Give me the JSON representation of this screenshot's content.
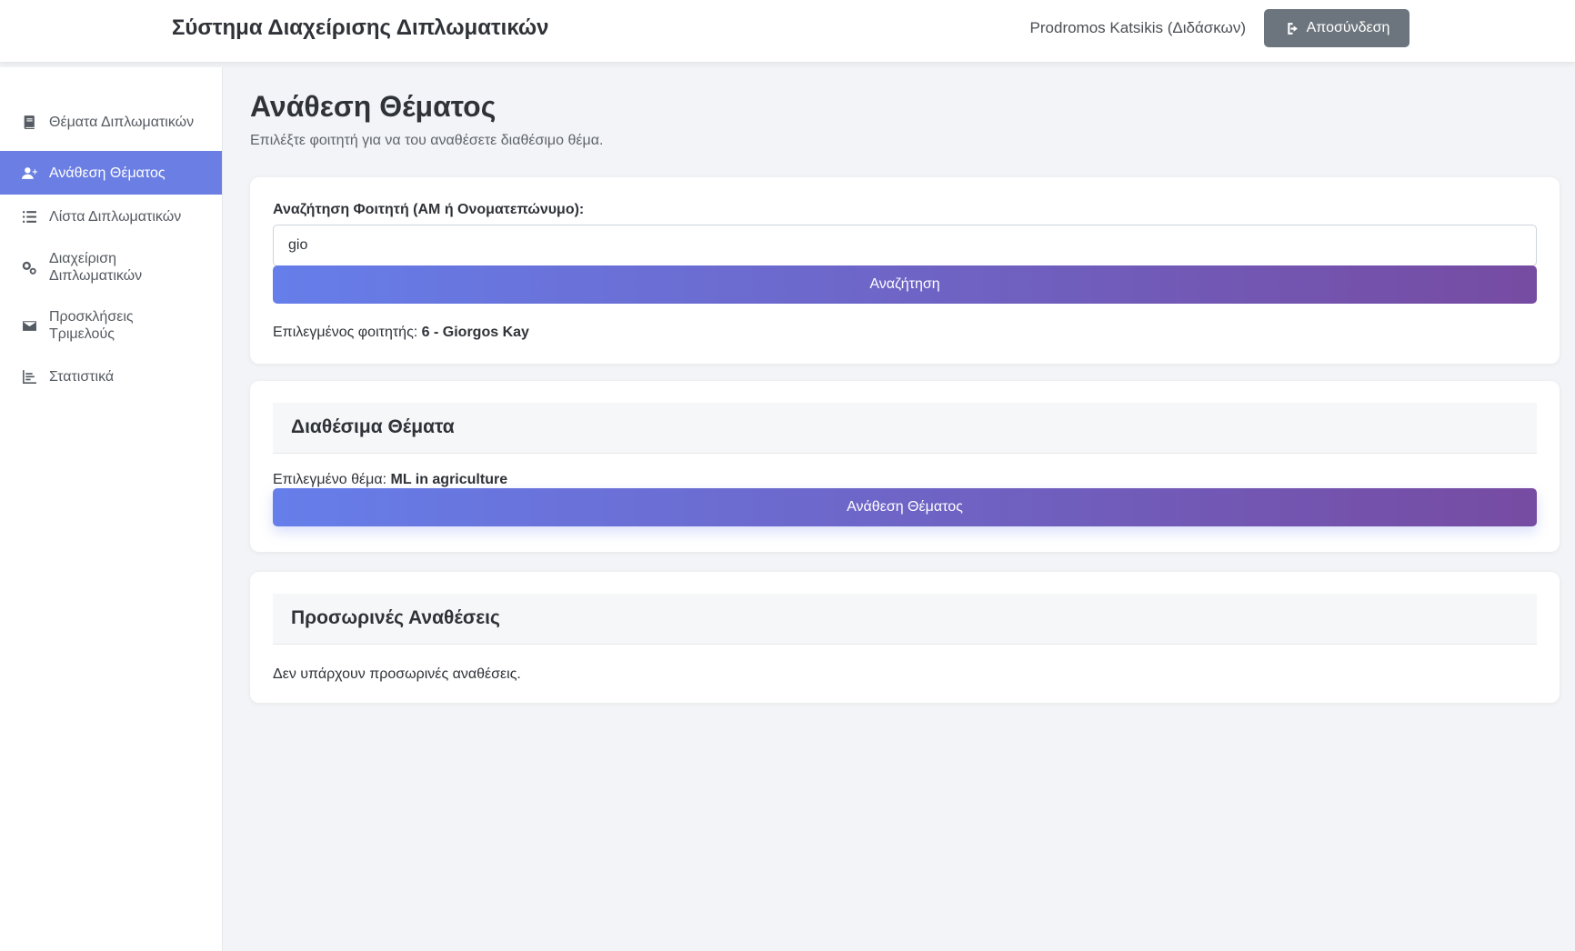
{
  "header": {
    "app_title": "Σύστημα Διαχείρισης Διπλωματικών",
    "user_name": "Prodromos Katsikis (Διδάσκων)",
    "logout_label": "Αποσύνδεση"
  },
  "sidebar": {
    "items": [
      {
        "label": "Θέματα Διπλωματικών",
        "icon": "book-icon",
        "active": false
      },
      {
        "label": "Ανάθεση Θέματος",
        "icon": "user-plus-icon",
        "active": true
      },
      {
        "label": "Λίστα Διπλωματικών",
        "icon": "list-icon",
        "active": false
      },
      {
        "label": "Διαχείριση Διπλωματικών",
        "icon": "gears-icon",
        "active": false
      },
      {
        "label": "Προσκλήσεις Τριμελούς",
        "icon": "envelope-icon",
        "active": false
      },
      {
        "label": "Στατιστικά",
        "icon": "chart-icon",
        "active": false
      }
    ],
    "active_color": "#6a7ee3"
  },
  "main": {
    "title": "Ανάθεση Θέματος",
    "subtitle": "Επιλέξτε φοιτητή για να του αναθέσετε διαθέσιμο θέμα.",
    "search": {
      "label": "Αναζήτηση Φοιτητή (ΑΜ ή Ονοματεπώνυμο):",
      "value": "gio",
      "button_label": "Αναζήτηση",
      "selected_prefix": "Επιλεγμένος φοιτητής:",
      "selected_value": "6 - Giorgos Kay"
    },
    "topics": {
      "heading": "Διαθέσιμα Θέματα",
      "selected_prefix": "Επιλεγμένο θέμα:",
      "selected_value": "ML in agriculture",
      "button_label": "Ανάθεση Θέματος"
    },
    "temp": {
      "heading": "Προσωρινές Αναθέσεις",
      "empty_text": "Δεν υπάρχουν προσωρινές αναθέσεις."
    }
  },
  "colors": {
    "gradient_start": "#667eea",
    "gradient_end": "#764ba2",
    "logout_bg": "#6c757d"
  }
}
